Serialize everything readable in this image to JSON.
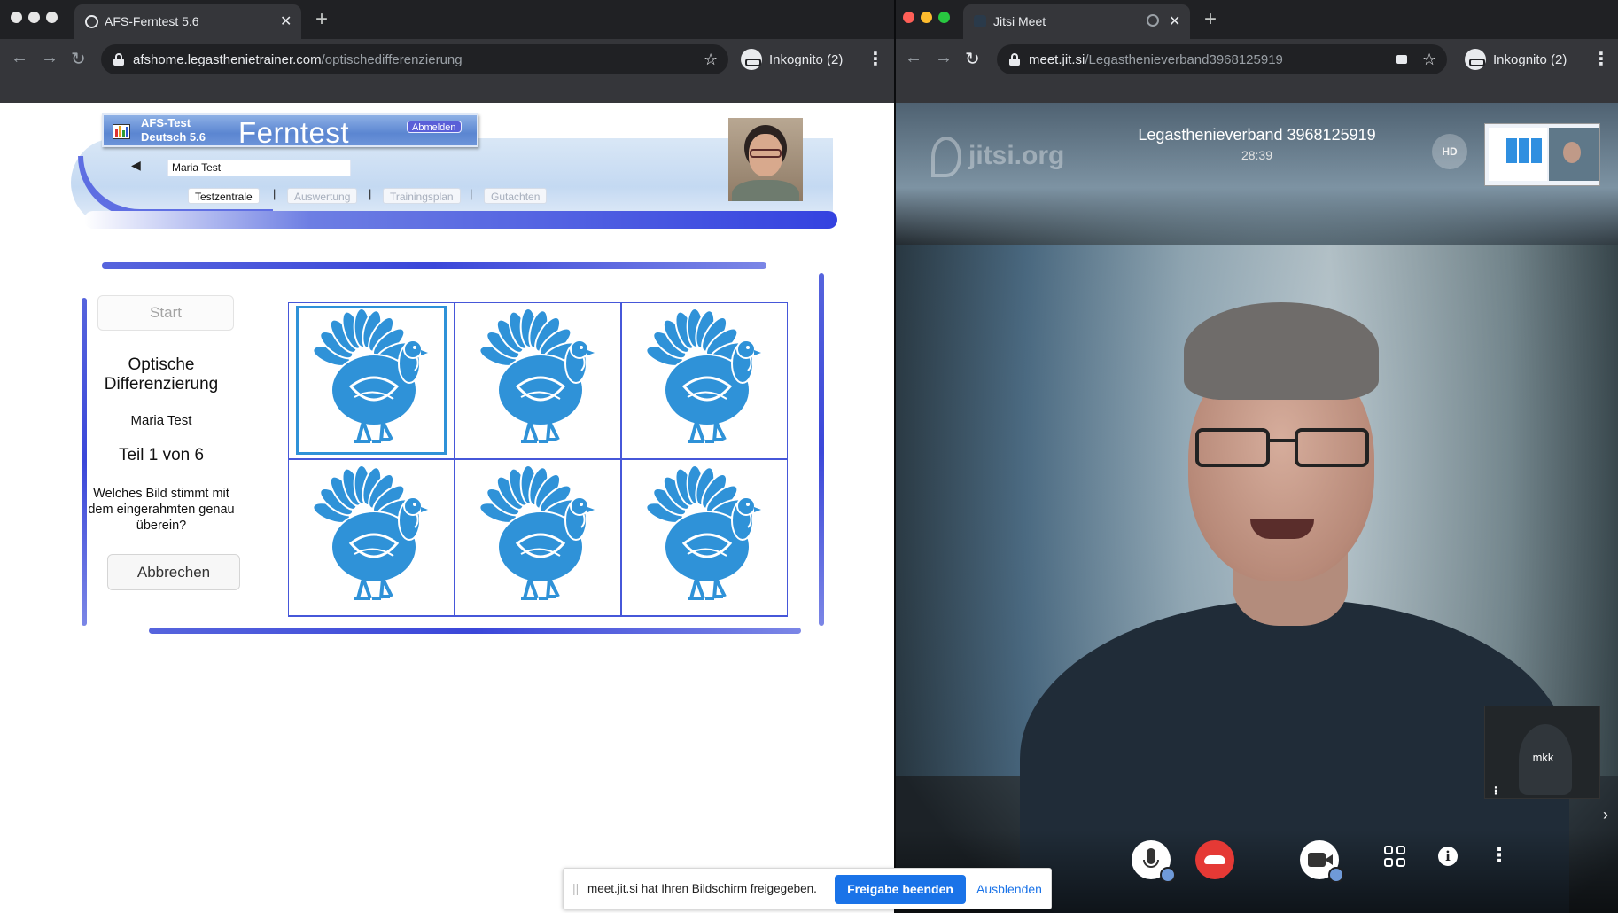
{
  "left_browser": {
    "tab_title": "AFS-Ferntest 5.6",
    "url_host": "afshome.legasthenietrainer.com",
    "url_path": "/optischedifferenzierung",
    "incognito_label": "Inkognito (2)"
  },
  "afs_page": {
    "logo_line1": "AFS-Test",
    "logo_line2": "Deutsch 5.6",
    "logo_title": "Ferntest",
    "logout_label": "Abmelden",
    "user_name": "Maria Test",
    "nav_tabs": [
      "Testzentrale",
      "Auswertung",
      "Trainingsplan",
      "Gutachten"
    ],
    "start_label": "Start",
    "task_title": "Optische Differenzierung",
    "participant": "Maria Test",
    "part": "Teil 1 von 6",
    "question": "Welches Bild stimmt mit dem eingerahmten genau überein?",
    "cancel_label": "Abbrechen",
    "grid_cells": 6,
    "selected_cell": 1,
    "turkey_color": "#2f92d8",
    "accent_color": "#3b47d9"
  },
  "right_browser": {
    "tab_title": "Jitsi Meet",
    "url_host": "meet.jit.si",
    "url_path": "/Legasthenieverband3968125919",
    "incognito_label": "Inkognito (2)"
  },
  "jitsi": {
    "watermark": "jitsi.org",
    "room_name": "Legasthenieverband 3968125919",
    "elapsed": "28:39",
    "quality_badge": "HD",
    "local_participant": "mkk"
  },
  "share_notice": {
    "message": "meet.jit.si hat Ihren Bildschirm freigegeben.",
    "stop_label": "Freigabe beenden",
    "hide_label": "Ausblenden"
  }
}
